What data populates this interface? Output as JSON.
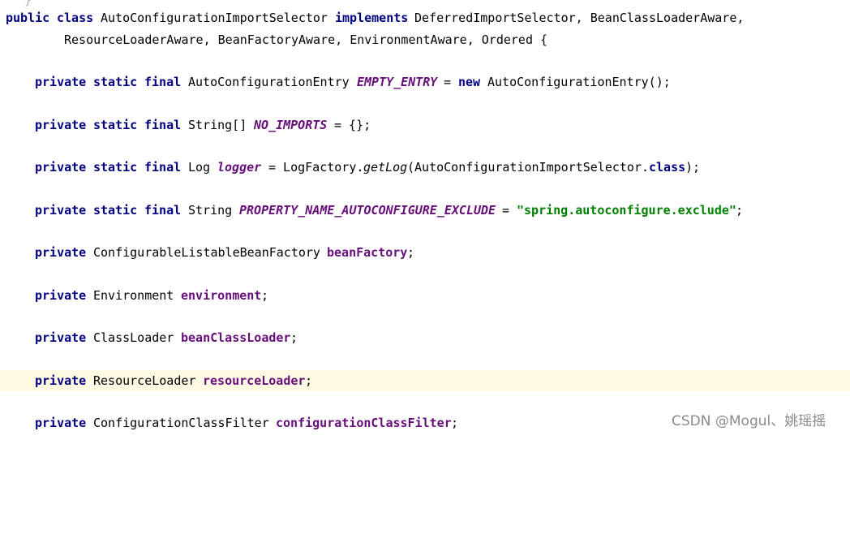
{
  "editor": {
    "lines": [
      {
        "id": "top-fragment",
        "indent": 0,
        "tokens": [
          {
            "t": "punct-fragment",
            "text": "}"
          }
        ]
      },
      {
        "id": "class-declaration",
        "indent": 0,
        "tokens": [
          {
            "t": "kw",
            "text": "public"
          },
          {
            "t": "kw",
            "text": "class"
          },
          {
            "t": "plain",
            "text": "AutoConfigurationImportSelector"
          },
          {
            "t": "kw",
            "text": "implements"
          },
          {
            "t": "plain",
            "text": "DeferredImportSelector, BeanClassLoaderAware,"
          }
        ]
      },
      {
        "id": "class-declaration-continued",
        "indent": 0,
        "tokens": [
          {
            "t": "plain",
            "text": "ResourceLoaderAware, BeanFactoryAware, EnvironmentAware, Ordered {"
          }
        ]
      },
      {
        "id": "empty-entry",
        "indent": 1,
        "tokens": [
          {
            "t": "kw",
            "text": "private"
          },
          {
            "t": "kw",
            "text": "static"
          },
          {
            "t": "kw",
            "text": "final"
          },
          {
            "t": "plain",
            "text": "AutoConfigurationEntry"
          },
          {
            "t": "konst",
            "text": "EMPTY_ENTRY"
          },
          {
            "t": "plain",
            "text": "="
          },
          {
            "t": "kw",
            "text": "new"
          },
          {
            "t": "plain",
            "text": "AutoConfigurationEntry();"
          }
        ]
      },
      {
        "id": "no-imports",
        "indent": 1,
        "tokens": [
          {
            "t": "kw",
            "text": "private"
          },
          {
            "t": "kw",
            "text": "static"
          },
          {
            "t": "kw",
            "text": "final"
          },
          {
            "t": "plain",
            "text": "String[]"
          },
          {
            "t": "konst",
            "text": "NO_IMPORTS"
          },
          {
            "t": "plain",
            "text": "= {};"
          }
        ]
      },
      {
        "id": "logger",
        "indent": 1,
        "tokens": [
          {
            "t": "kw",
            "text": "private"
          },
          {
            "t": "kw",
            "text": "static"
          },
          {
            "t": "kw",
            "text": "final"
          },
          {
            "t": "plain",
            "text": "Log"
          },
          {
            "t": "konst",
            "text": "logger"
          },
          {
            "t": "plain",
            "text": "= LogFactory."
          },
          {
            "t": "smethod",
            "text": "getLog"
          },
          {
            "t": "plain",
            "text": "(AutoConfigurationImportSelector."
          },
          {
            "t": "kw",
            "text": "class"
          },
          {
            "t": "plain",
            "text": ");"
          }
        ]
      },
      {
        "id": "property-name",
        "indent": 1,
        "tokens": [
          {
            "t": "kw",
            "text": "private"
          },
          {
            "t": "kw",
            "text": "static"
          },
          {
            "t": "kw",
            "text": "final"
          },
          {
            "t": "plain",
            "text": "String"
          },
          {
            "t": "konst",
            "text": "PROPERTY_NAME_AUTOCONFIGURE_EXCLUDE"
          },
          {
            "t": "plain",
            "text": "="
          },
          {
            "t": "str",
            "text": "\"spring.autoconfigure.exclude\""
          },
          {
            "t": "plain",
            "text": ";"
          }
        ]
      },
      {
        "id": "bean-factory",
        "indent": 1,
        "tokens": [
          {
            "t": "kw",
            "text": "private"
          },
          {
            "t": "plain",
            "text": "ConfigurableListableBeanFactory"
          },
          {
            "t": "field",
            "text": "beanFactory"
          },
          {
            "t": "plain",
            "text": ";"
          }
        ]
      },
      {
        "id": "environment",
        "indent": 1,
        "tokens": [
          {
            "t": "kw",
            "text": "private"
          },
          {
            "t": "plain",
            "text": "Environment"
          },
          {
            "t": "field",
            "text": "environment"
          },
          {
            "t": "plain",
            "text": ";"
          }
        ]
      },
      {
        "id": "bean-class-loader",
        "indent": 1,
        "tokens": [
          {
            "t": "kw",
            "text": "private"
          },
          {
            "t": "plain",
            "text": "ClassLoader"
          },
          {
            "t": "field",
            "text": "beanClassLoader"
          },
          {
            "t": "plain",
            "text": ";"
          }
        ]
      },
      {
        "id": "resource-loader",
        "indent": 1,
        "caret": true,
        "tokens": [
          {
            "t": "kw",
            "text": "private"
          },
          {
            "t": "plain",
            "text": "ResourceLoader"
          },
          {
            "t": "field",
            "text": "resourceLoader"
          },
          {
            "t": "plain",
            "text": ";"
          }
        ]
      },
      {
        "id": "configuration-class-filter",
        "indent": 1,
        "tokens": [
          {
            "t": "kw",
            "text": "private"
          },
          {
            "t": "plain",
            "text": "ConfigurationClassFilter"
          },
          {
            "t": "field",
            "text": "configurationClassFilter"
          },
          {
            "t": "plain",
            "text": ";"
          }
        ]
      }
    ]
  },
  "watermark": {
    "text": "CSDN @Mogul、姚瑶摇"
  },
  "colors": {
    "keyword": "#000080",
    "constant": "#660e7a",
    "field": "#660e7a",
    "string": "#008000",
    "caret_line": "#fffae3"
  }
}
